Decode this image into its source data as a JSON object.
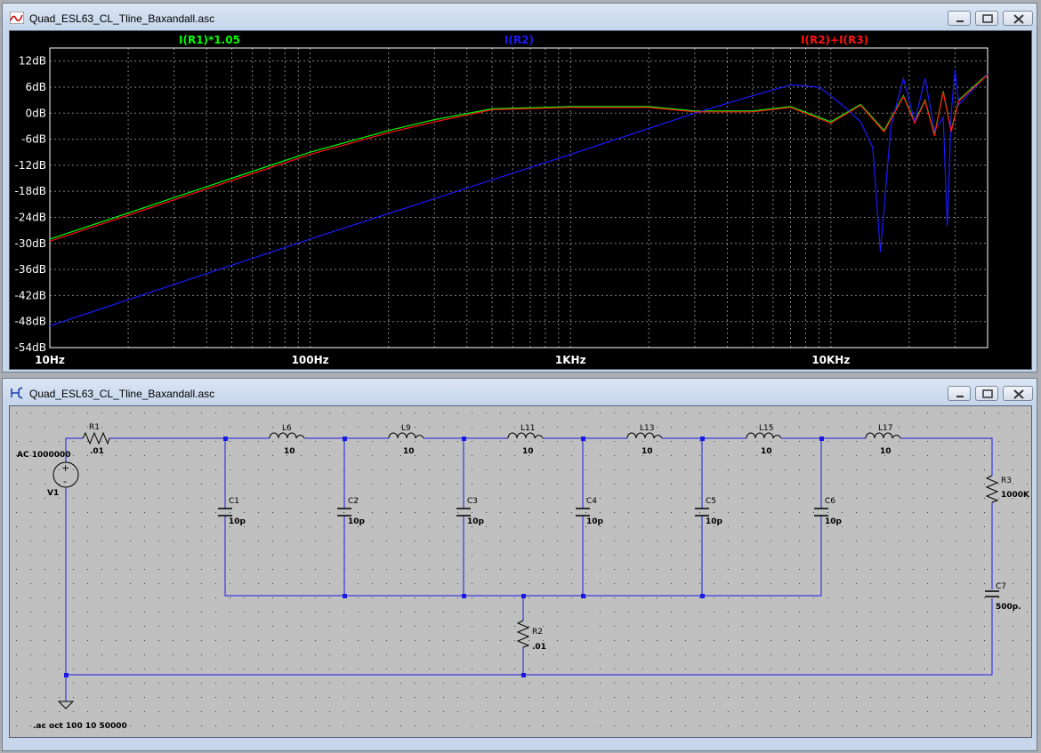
{
  "plot_window": {
    "title": "Quad_ESL63_CL_Tline_Baxandall.asc",
    "traces": [
      {
        "label": "I(R1)*1.05",
        "color": "#00ff00"
      },
      {
        "label": "I(R2)",
        "color": "#1a1aff"
      },
      {
        "label": "I(R2)+I(R3)",
        "color": "#ff1010"
      }
    ],
    "y_ticks": [
      "12dB",
      "6dB",
      "0dB",
      "-6dB",
      "-12dB",
      "-18dB",
      "-24dB",
      "-30dB",
      "-36dB",
      "-42dB",
      "-48dB",
      "-54dB"
    ],
    "x_ticks": [
      "10Hz",
      "100Hz",
      "1KHz",
      "10KHz"
    ]
  },
  "schematic_window": {
    "title": "Quad_ESL63_CL_Tline_Baxandall.asc",
    "source": {
      "name": "V1",
      "value": "AC 1000000"
    },
    "r1": {
      "name": "R1",
      "value": ".01"
    },
    "r2": {
      "name": "R2",
      "value": ".01"
    },
    "r3": {
      "name": "R3",
      "value": "1000K"
    },
    "c7": {
      "name": "C7",
      "value": "500p."
    },
    "inductors": [
      {
        "name": "L6",
        "value": "10"
      },
      {
        "name": "L9",
        "value": "10"
      },
      {
        "name": "L11",
        "value": "10"
      },
      {
        "name": "L13",
        "value": "10"
      },
      {
        "name": "L15",
        "value": "10"
      },
      {
        "name": "L17",
        "value": "10"
      }
    ],
    "capacitors": [
      {
        "name": "C1",
        "value": "10p"
      },
      {
        "name": "C2",
        "value": "10p"
      },
      {
        "name": "C3",
        "value": "10p"
      },
      {
        "name": "C4",
        "value": "10p"
      },
      {
        "name": "C5",
        "value": "10p"
      },
      {
        "name": "C6",
        "value": "10p"
      }
    ],
    "directive": ".ac oct 100 10 50000"
  },
  "chart_data": {
    "type": "line",
    "xscale": "log",
    "xlim": [
      10,
      40000
    ],
    "ylim": [
      -54,
      15
    ],
    "grid": true,
    "ylabel_unit": "dB",
    "series": [
      {
        "name": "I(R1)*1.05",
        "color": "#00ff00",
        "x": [
          10,
          20,
          50,
          100,
          200,
          300,
          500,
          1000,
          2000,
          3000,
          5000,
          7000,
          10000,
          13000,
          16000,
          19000,
          21000,
          23000,
          25000,
          27000,
          29000,
          31000,
          40000
        ],
        "y": [
          -29,
          -23,
          -15,
          -9,
          -4,
          -1.5,
          1,
          1.5,
          1.5,
          0.5,
          0.5,
          1.5,
          -2,
          2,
          -4,
          4,
          -2,
          3,
          -5,
          5,
          -4,
          3,
          9
        ]
      },
      {
        "name": "I(R2)",
        "color": "#1a1aff",
        "x": [
          10,
          100,
          1000,
          3000,
          5000,
          7000,
          9000,
          10000,
          11500,
          13000,
          14500,
          15500,
          17000,
          19000,
          21000,
          23000,
          25000,
          27000,
          28000,
          29000,
          30000,
          31000,
          40000
        ],
        "y": [
          -49,
          -29,
          -9.5,
          0,
          4,
          6.5,
          6,
          4,
          1,
          -2,
          -8,
          -32,
          -3,
          8,
          -2,
          8,
          -4,
          -1,
          -26,
          0,
          10,
          2,
          9
        ]
      },
      {
        "name": "I(R2)+I(R3)",
        "color": "#ff1010",
        "x": [
          10,
          20,
          50,
          100,
          200,
          300,
          500,
          1000,
          2000,
          3000,
          5000,
          7000,
          10000,
          13000,
          16000,
          19000,
          21000,
          23000,
          25000,
          27000,
          29000,
          31000,
          40000
        ],
        "y": [
          -29.5,
          -23.5,
          -15.5,
          -9.5,
          -4.5,
          -2,
          0.8,
          1.3,
          1.3,
          0.3,
          0.3,
          1.3,
          -2.3,
          1.8,
          -4.3,
          3.8,
          -2.3,
          2.8,
          -5.3,
          4.8,
          -4.3,
          2.8,
          8.8
        ]
      }
    ]
  }
}
